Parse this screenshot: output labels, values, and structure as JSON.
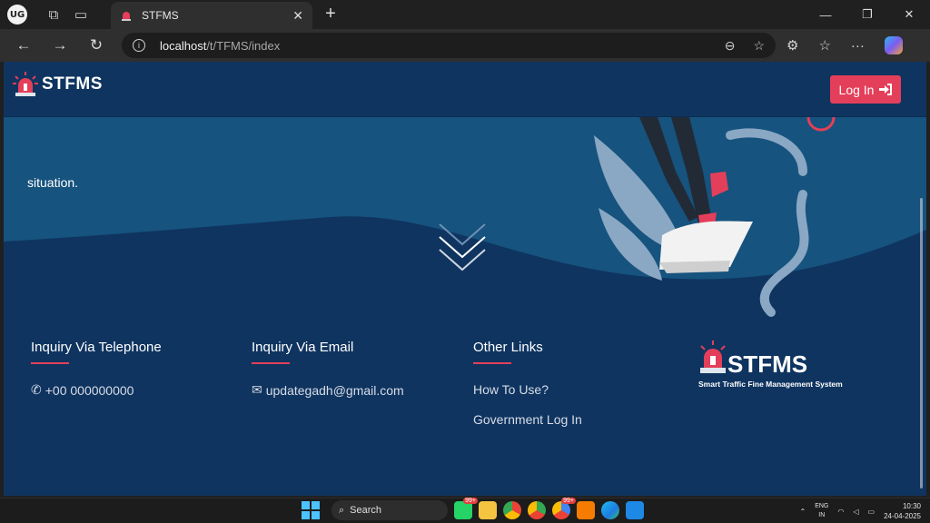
{
  "browser": {
    "profile_initials": "UG",
    "tab_title": "STFMS",
    "url_host": "localhost",
    "url_path": "/t/TFMS/index"
  },
  "header": {
    "brand": "STFMS",
    "login_label": "Log In"
  },
  "hero": {
    "text": "situation."
  },
  "footer": {
    "telephone": {
      "heading": "Inquiry Via Telephone",
      "value": "+00 000000000"
    },
    "email": {
      "heading": "Inquiry Via Email",
      "value": "updategadh@gmail.com"
    },
    "links": {
      "heading": "Other Links",
      "items": [
        "How To Use?",
        "Government Log In"
      ]
    },
    "logo": {
      "name": "STFMS",
      "tagline": "Smart Traffic Fine Management System"
    }
  },
  "taskbar": {
    "search_label": "Search",
    "badge_a": "99+",
    "badge_b": "99+",
    "lang_top": "ENG",
    "lang_bottom": "IN",
    "time": "10:30",
    "date": "24-04-2025"
  },
  "colors": {
    "page_bg": "#0f3460",
    "wave": "#16537e",
    "accent": "#e43f5a"
  }
}
